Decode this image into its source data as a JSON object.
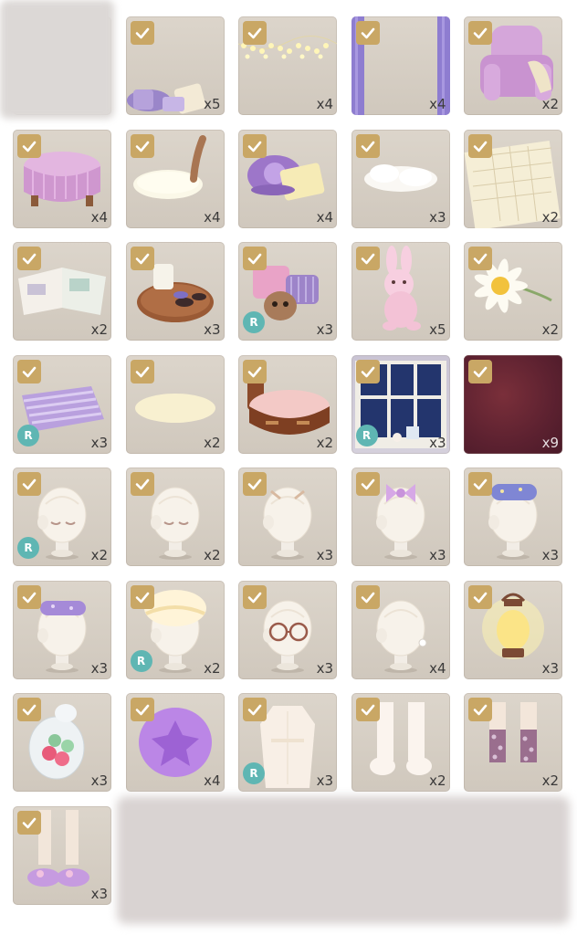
{
  "badges": {
    "check": "check-icon",
    "rare_label": "R"
  },
  "items": [
    {
      "name": "hidden-item",
      "count": "",
      "rare": false,
      "checked": false,
      "art": "blank"
    },
    {
      "name": "pillows-pile",
      "count": "x5",
      "rare": false,
      "checked": true,
      "art": "pillows"
    },
    {
      "name": "fairy-lights",
      "count": "x4",
      "rare": false,
      "checked": true,
      "art": "lights"
    },
    {
      "name": "purple-curtains",
      "count": "x4",
      "rare": false,
      "checked": true,
      "art": "curtains"
    },
    {
      "name": "pink-armchair",
      "count": "x2",
      "rare": false,
      "checked": true,
      "art": "armchair"
    },
    {
      "name": "pink-ottoman",
      "count": "x4",
      "rare": false,
      "checked": true,
      "art": "ottoman"
    },
    {
      "name": "milk-bowl",
      "count": "x4",
      "rare": false,
      "checked": true,
      "art": "bowl"
    },
    {
      "name": "flower-cushion",
      "count": "x4",
      "rare": false,
      "checked": true,
      "art": "cushion"
    },
    {
      "name": "fluffy-rug",
      "count": "x3",
      "rare": false,
      "checked": true,
      "art": "fluff"
    },
    {
      "name": "open-planner",
      "count": "x2",
      "rare": false,
      "checked": true,
      "art": "planner"
    },
    {
      "name": "open-magazine",
      "count": "x2",
      "rare": false,
      "checked": true,
      "art": "magazine"
    },
    {
      "name": "tea-tray",
      "count": "x3",
      "rare": false,
      "checked": true,
      "art": "tray"
    },
    {
      "name": "plush-pillows",
      "count": "x3",
      "rare": true,
      "checked": true,
      "art": "plushpillows"
    },
    {
      "name": "bunny-plush",
      "count": "x5",
      "rare": false,
      "checked": true,
      "art": "bunny"
    },
    {
      "name": "daisy-flower",
      "count": "x2",
      "rare": false,
      "checked": true,
      "art": "daisy"
    },
    {
      "name": "striped-blanket",
      "count": "x3",
      "rare": true,
      "checked": true,
      "art": "blanket"
    },
    {
      "name": "round-rug",
      "count": "x2",
      "rare": false,
      "checked": true,
      "art": "rug"
    },
    {
      "name": "round-bed",
      "count": "x2",
      "rare": false,
      "checked": true,
      "art": "bed"
    },
    {
      "name": "night-window",
      "count": "x3",
      "rare": true,
      "checked": true,
      "art": "window"
    },
    {
      "name": "wine-wallpaper",
      "count": "x9",
      "rare": false,
      "checked": true,
      "art": "wallpaper"
    },
    {
      "name": "sleepy-eyes",
      "count": "x2",
      "rare": true,
      "checked": true,
      "art": "head-eyes"
    },
    {
      "name": "sleepy-eyes-2",
      "count": "x2",
      "rare": false,
      "checked": true,
      "art": "head-eyes"
    },
    {
      "name": "hair-clips",
      "count": "x3",
      "rare": false,
      "checked": true,
      "art": "head-clips"
    },
    {
      "name": "purple-bow",
      "count": "x3",
      "rare": false,
      "checked": true,
      "art": "head-bow"
    },
    {
      "name": "sleep-mask-blue",
      "count": "x3",
      "rare": false,
      "checked": true,
      "art": "head-mask"
    },
    {
      "name": "sleep-mask-purple",
      "count": "x3",
      "rare": false,
      "checked": true,
      "art": "head-mask2"
    },
    {
      "name": "bonnet",
      "count": "x2",
      "rare": true,
      "checked": true,
      "art": "head-bonnet"
    },
    {
      "name": "round-glasses",
      "count": "x3",
      "rare": false,
      "checked": true,
      "art": "head-glasses"
    },
    {
      "name": "earring",
      "count": "x4",
      "rare": false,
      "checked": true,
      "art": "head-plain"
    },
    {
      "name": "lantern",
      "count": "x3",
      "rare": false,
      "checked": true,
      "art": "lantern"
    },
    {
      "name": "candy-jar",
      "count": "x3",
      "rare": false,
      "checked": true,
      "art": "jar"
    },
    {
      "name": "purple-pouf",
      "count": "x4",
      "rare": false,
      "checked": true,
      "art": "pouf"
    },
    {
      "name": "fluffy-robe",
      "count": "x3",
      "rare": true,
      "checked": true,
      "art": "robe"
    },
    {
      "name": "fluffy-socks",
      "count": "x2",
      "rare": false,
      "checked": true,
      "art": "socks"
    },
    {
      "name": "dotted-socks",
      "count": "x2",
      "rare": false,
      "checked": true,
      "art": "socks-dot"
    },
    {
      "name": "bunny-slippers",
      "count": "x3",
      "rare": false,
      "checked": true,
      "art": "slippers"
    }
  ]
}
